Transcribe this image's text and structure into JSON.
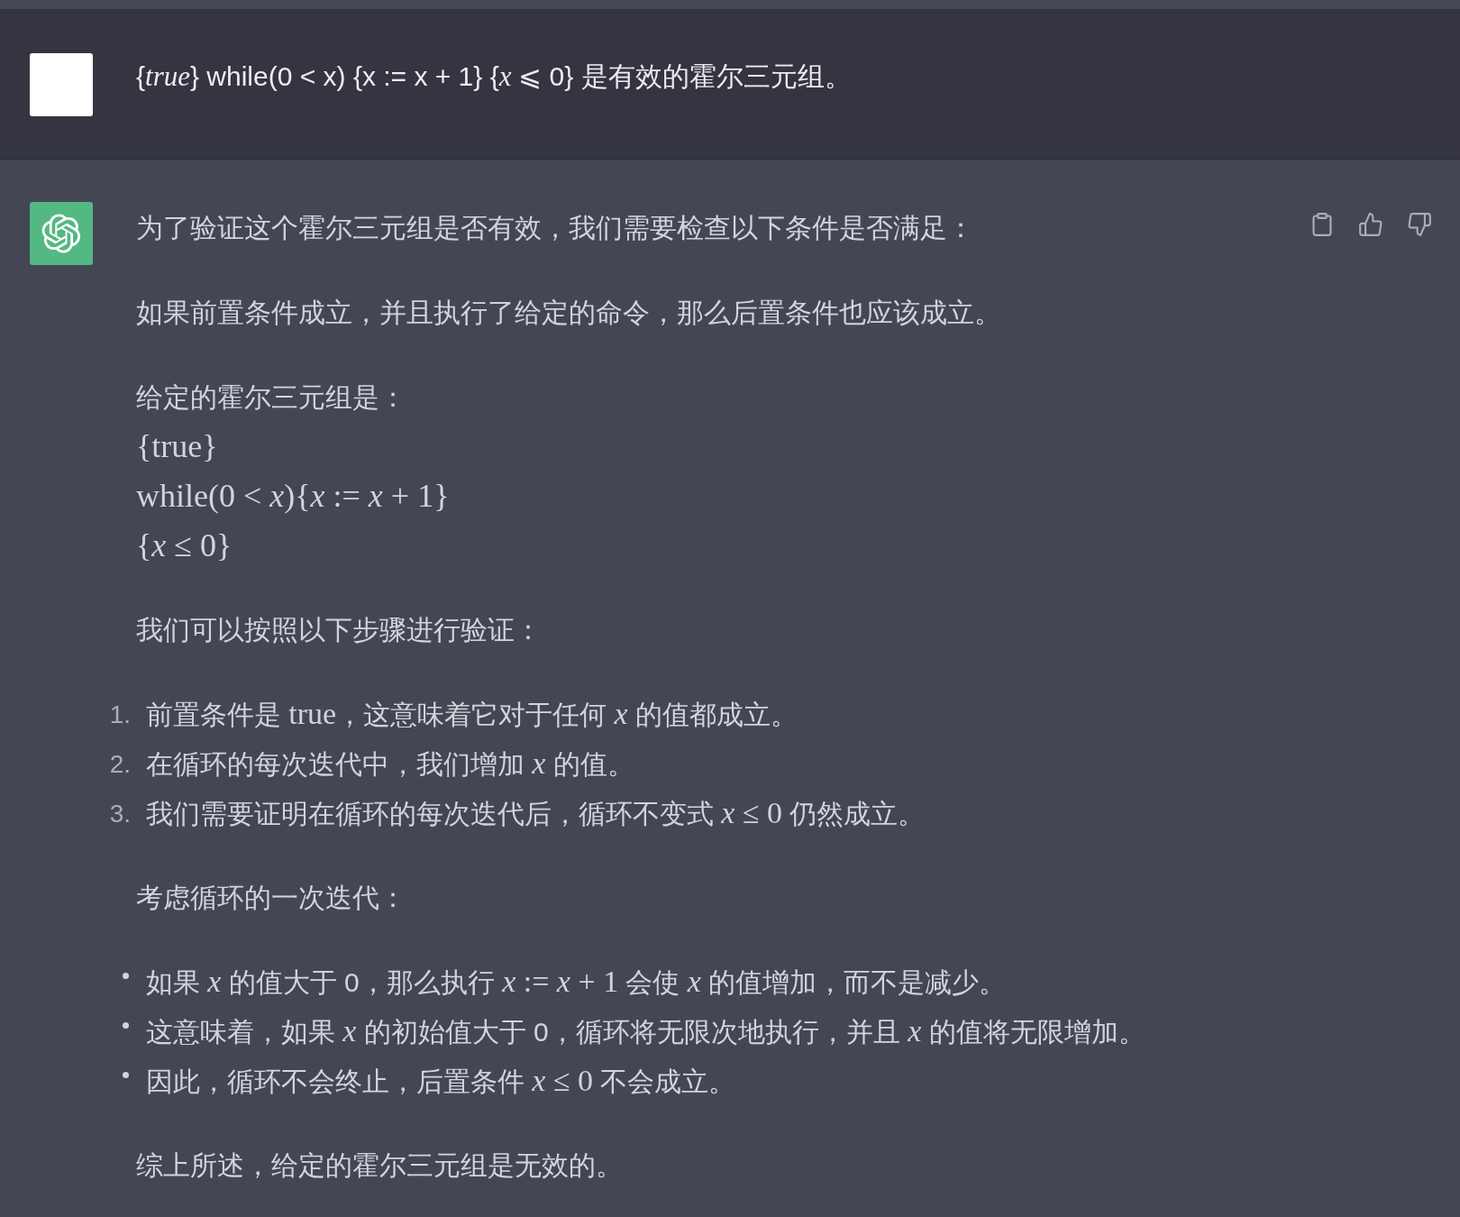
{
  "user_message": {
    "segments": [
      {
        "kind": "text",
        "text": "{"
      },
      {
        "kind": "math",
        "text": "*true*"
      },
      {
        "kind": "text",
        "text": "} while(0 < x) {x := x + 1} {"
      },
      {
        "kind": "math",
        "text": "*x* ⩽"
      },
      {
        "kind": "text",
        "text": " 0} 是有效的霍尔三元组。"
      }
    ]
  },
  "assistant_message": {
    "blocks": [
      {
        "kind": "paragraph",
        "segments": [
          {
            "kind": "text",
            "text": "为了验证这个霍尔三元组是否有效，我们需要检查以下条件是否满足："
          }
        ]
      },
      {
        "kind": "paragraph",
        "segments": [
          {
            "kind": "text",
            "text": "如果前置条件成立，并且执行了给定的命令，那么后置条件也应该成立。"
          }
        ]
      },
      {
        "kind": "paragraph",
        "segments": [
          {
            "kind": "text",
            "text": "给定的霍尔三元组是："
          }
        ]
      },
      {
        "kind": "math",
        "lines": [
          "{true}",
          "while(0 < *x*){*x* := *x* + 1}",
          "{*x* ≤ 0}"
        ]
      },
      {
        "kind": "paragraph",
        "segments": [
          {
            "kind": "text",
            "text": "我们可以按照以下步骤进行验证："
          }
        ]
      },
      {
        "kind": "ordered_list",
        "items": [
          {
            "number": "1.",
            "segments": [
              {
                "kind": "text",
                "text": "前置条件是 "
              },
              {
                "kind": "math",
                "text": "true"
              },
              {
                "kind": "text",
                "text": "，这意味着它对于任何 "
              },
              {
                "kind": "math",
                "text": "*x*"
              },
              {
                "kind": "text",
                "text": " 的值都成立。"
              }
            ]
          },
          {
            "number": "2.",
            "segments": [
              {
                "kind": "text",
                "text": "在循环的每次迭代中，我们增加 "
              },
              {
                "kind": "math",
                "text": "*x*"
              },
              {
                "kind": "text",
                "text": " 的值。"
              }
            ]
          },
          {
            "number": "3.",
            "segments": [
              {
                "kind": "text",
                "text": "我们需要证明在循环的每次迭代后，循环不变式 "
              },
              {
                "kind": "math",
                "text": "*x* ≤ 0"
              },
              {
                "kind": "text",
                "text": " 仍然成立。"
              }
            ]
          }
        ]
      },
      {
        "kind": "paragraph",
        "segments": [
          {
            "kind": "text",
            "text": "考虑循环的一次迭代："
          }
        ]
      },
      {
        "kind": "bullet_list",
        "items": [
          {
            "segments": [
              {
                "kind": "text",
                "text": "如果 "
              },
              {
                "kind": "math",
                "text": "*x*"
              },
              {
                "kind": "text",
                "text": " 的值大于 0，那么执行 "
              },
              {
                "kind": "math",
                "text": "*x* := *x* + 1"
              },
              {
                "kind": "text",
                "text": " 会使 "
              },
              {
                "kind": "math",
                "text": "*x*"
              },
              {
                "kind": "text",
                "text": " 的值增加，而不是减少。"
              }
            ]
          },
          {
            "segments": [
              {
                "kind": "text",
                "text": "这意味着，如果 "
              },
              {
                "kind": "math",
                "text": "*x*"
              },
              {
                "kind": "text",
                "text": " 的初始值大于 0，循环将无限次地执行，并且 "
              },
              {
                "kind": "math",
                "text": "*x*"
              },
              {
                "kind": "text",
                "text": " 的值将无限增加。"
              }
            ]
          },
          {
            "segments": [
              {
                "kind": "text",
                "text": "因此，循环不会终止，后置条件 "
              },
              {
                "kind": "math",
                "text": "*x* ≤ 0"
              },
              {
                "kind": "text",
                "text": " 不会成立。"
              }
            ]
          }
        ]
      },
      {
        "kind": "paragraph",
        "segments": [
          {
            "kind": "text",
            "text": "综上所述，给定的霍尔三元组是无效的。"
          }
        ]
      }
    ]
  }
}
